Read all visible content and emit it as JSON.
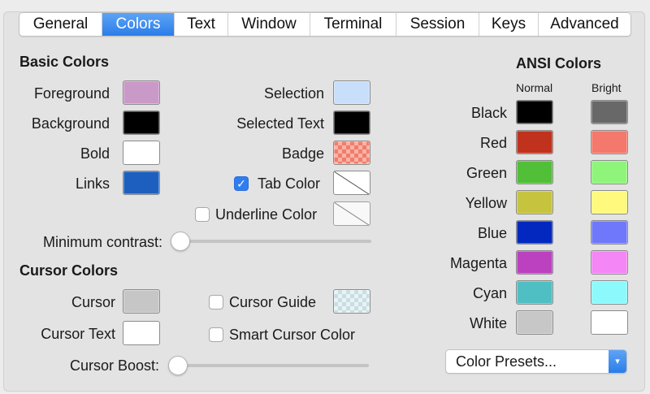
{
  "tabs": [
    {
      "label": "General"
    },
    {
      "label": "Colors",
      "active": true
    },
    {
      "label": "Text"
    },
    {
      "label": "Window"
    },
    {
      "label": "Terminal"
    },
    {
      "label": "Session"
    },
    {
      "label": "Keys"
    },
    {
      "label": "Advanced"
    }
  ],
  "basic": {
    "heading": "Basic Colors",
    "foreground": {
      "label": "Foreground",
      "color": "#c999c8"
    },
    "background": {
      "label": "Background",
      "color": "#000000"
    },
    "bold": {
      "label": "Bold",
      "color": "#ffffff"
    },
    "links": {
      "label": "Links",
      "color": "#1d5fbf"
    },
    "selection": {
      "label": "Selection",
      "color": "#c8dffb"
    },
    "selected_text": {
      "label": "Selected Text",
      "color": "#000000"
    },
    "badge": {
      "label": "Badge",
      "color": "#f07c6b"
    },
    "tab_color": {
      "label": "Tab Color",
      "checked": true
    },
    "underline_color": {
      "label": "Underline Color",
      "checked": false
    },
    "min_contrast": {
      "label": "Minimum contrast:",
      "value": 0
    }
  },
  "cursor": {
    "heading": "Cursor Colors",
    "cursor": {
      "label": "Cursor",
      "color": "#c6c6c6"
    },
    "cursor_text": {
      "label": "Cursor Text",
      "color": "#ffffff"
    },
    "cursor_guide": {
      "label": "Cursor Guide",
      "checked": false
    },
    "smart_cursor": {
      "label": "Smart Cursor Color",
      "checked": false
    },
    "boost": {
      "label": "Cursor Boost:",
      "value": 0
    }
  },
  "ansi": {
    "heading": "ANSI Colors",
    "normal_label": "Normal",
    "bright_label": "Bright",
    "rows": [
      {
        "name": "Black",
        "normal": "#000000",
        "bright": "#686868"
      },
      {
        "name": "Red",
        "normal": "#c0321d",
        "bright": "#f4786b"
      },
      {
        "name": "Green",
        "normal": "#51bf37",
        "bright": "#8ff57a"
      },
      {
        "name": "Yellow",
        "normal": "#c6c43f",
        "bright": "#fff97d"
      },
      {
        "name": "Blue",
        "normal": "#0228c0",
        "bright": "#6f78fb"
      },
      {
        "name": "Magenta",
        "normal": "#bb41c0",
        "bright": "#f486f5"
      },
      {
        "name": "Cyan",
        "normal": "#4fbfc3",
        "bright": "#8cfafd"
      },
      {
        "name": "White",
        "normal": "#c7c7c7",
        "bright": "#ffffff"
      }
    ]
  },
  "presets": {
    "label": "Color Presets...",
    "icon": "chevron-down-icon"
  }
}
